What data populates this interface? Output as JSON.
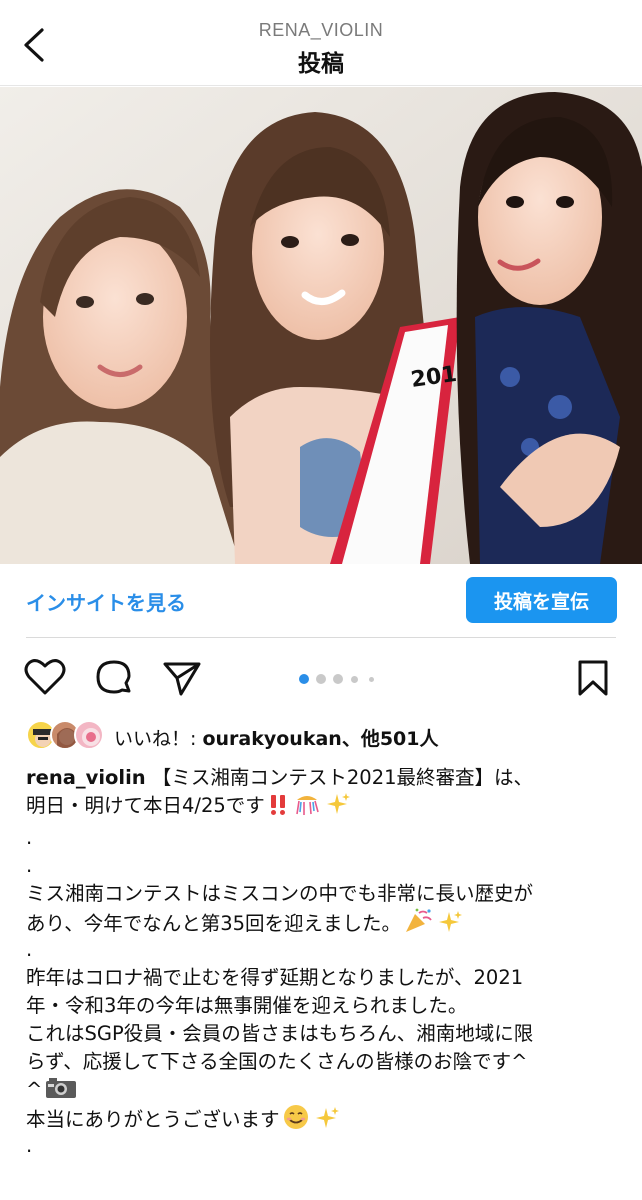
{
  "header": {
    "username": "RENA_VIOLIN",
    "title": "投稿"
  },
  "photo": {
    "sash_text": "201"
  },
  "insights": {
    "link_label": "インサイトを見る",
    "promote_label": "投稿を宣伝"
  },
  "carousel": {
    "count": 5,
    "active_index": 0
  },
  "likes": {
    "prefix": "いいね！: ",
    "user": "ourakyoukan",
    "suffix": "、他501人"
  },
  "caption": {
    "username": "rena_violin",
    "lines": [
      "【ミス湘南コンテスト2021最終審査】は、",
      "明日・明けて本日4/25です",
      ".",
      ".",
      "ミス湘南コンテストはミスコンの中でも非常に長い歴史が",
      "あり、今年でなんと第35回を迎えました。",
      ".",
      "昨年はコロナ禍で止むを得ず延期となりましたが、2021",
      "年・令和3年の今年は無事開催を迎えられました。",
      "これはSGP役員・会員の皆さまはもちろん、湘南地域に限",
      "らず、応援して下さる全国のたくさんの皆様のお陰です^",
      "^",
      "本当にありがとうございます",
      "."
    ]
  },
  "colors": {
    "accent": "#1b95f0",
    "link": "#2a8ee8",
    "muted": "#7a7a7a",
    "sash_red": "#d8243e"
  }
}
